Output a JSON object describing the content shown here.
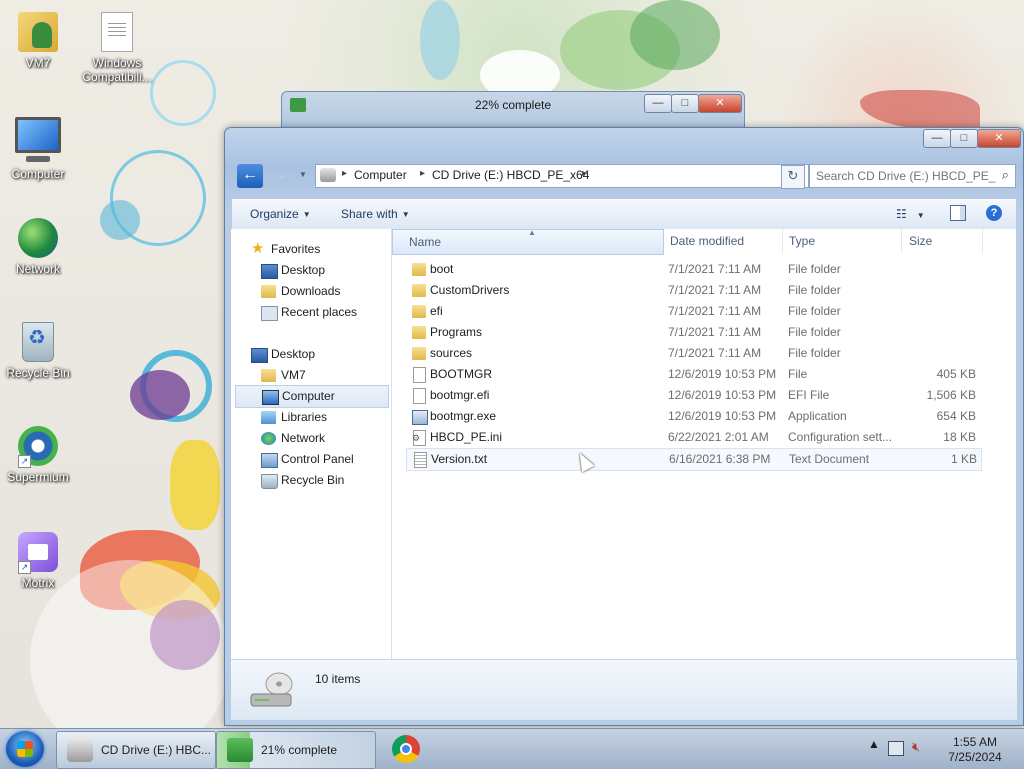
{
  "desktop": {
    "icons": [
      {
        "label": "VM7"
      },
      {
        "label": "Windows Compatibili..."
      },
      {
        "label": "Computer"
      },
      {
        "label": "Network"
      },
      {
        "label": "Recycle Bin"
      },
      {
        "label": "Supermium"
      },
      {
        "label": "Motrix"
      }
    ]
  },
  "copy_dialog": {
    "title": "22% complete",
    "controls": {
      "minimize": "—",
      "maximize": "□",
      "close": "✕"
    }
  },
  "explorer": {
    "controls": {
      "minimize": "—",
      "maximize": "□",
      "close": "✕"
    },
    "address": {
      "crumbs": [
        "Computer",
        "CD Drive (E:) HBCD_PE_x64"
      ]
    },
    "search": {
      "placeholder": "Search CD Drive (E:) HBCD_PE_..."
    },
    "toolbar": {
      "organize": "Organize",
      "share_with": "Share with"
    },
    "nav": {
      "favorites": "Favorites",
      "favorites_items": [
        "Desktop",
        "Downloads",
        "Recent places"
      ],
      "desktop": "Desktop",
      "desktop_items": [
        "VM7",
        "Computer",
        "Libraries",
        "Network",
        "Control Panel",
        "Recycle Bin"
      ],
      "selected": "Computer"
    },
    "columns": {
      "name": "Name",
      "date": "Date modified",
      "type": "Type",
      "size": "Size"
    },
    "files": [
      {
        "name": "boot",
        "date": "7/1/2021 7:11 AM",
        "type": "File folder",
        "size": "",
        "icon": "folder-icon"
      },
      {
        "name": "CustomDrivers",
        "date": "7/1/2021 7:11 AM",
        "type": "File folder",
        "size": "",
        "icon": "folder-icon"
      },
      {
        "name": "efi",
        "date": "7/1/2021 7:11 AM",
        "type": "File folder",
        "size": "",
        "icon": "folder-icon"
      },
      {
        "name": "Programs",
        "date": "7/1/2021 7:11 AM",
        "type": "File folder",
        "size": "",
        "icon": "folder-icon"
      },
      {
        "name": "sources",
        "date": "7/1/2021 7:11 AM",
        "type": "File folder",
        "size": "",
        "icon": "folder-icon"
      },
      {
        "name": "BOOTMGR",
        "date": "12/6/2019 10:53 PM",
        "type": "File",
        "size": "405 KB",
        "icon": "file-icon"
      },
      {
        "name": "bootmgr.efi",
        "date": "12/6/2019 10:53 PM",
        "type": "EFI File",
        "size": "1,506 KB",
        "icon": "file-icon"
      },
      {
        "name": "bootmgr.exe",
        "date": "12/6/2019 10:53 PM",
        "type": "Application",
        "size": "654 KB",
        "icon": "application-icon"
      },
      {
        "name": "HBCD_PE.ini",
        "date": "6/22/2021 2:01 AM",
        "type": "Configuration sett...",
        "size": "18 KB",
        "icon": "config-file-icon"
      },
      {
        "name": "Version.txt",
        "date": "6/16/2021 6:38 PM",
        "type": "Text Document",
        "size": "1 KB",
        "icon": "text-file-icon"
      }
    ],
    "details": {
      "count": "10 items"
    }
  },
  "taskbar": {
    "tasks": [
      {
        "label": "CD Drive (E:) HBC..."
      },
      {
        "label": "21% complete",
        "progress": 0.21
      }
    ],
    "clock": {
      "time": "1:55 AM",
      "date": "7/25/2024"
    }
  }
}
